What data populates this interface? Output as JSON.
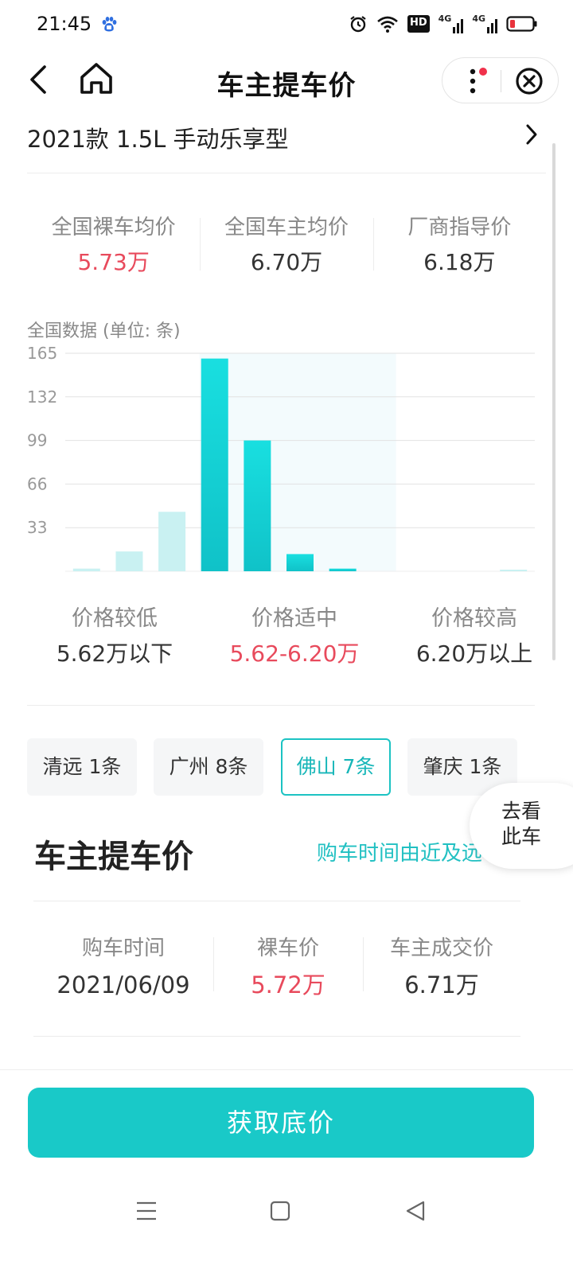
{
  "status_bar": {
    "time": "21:45",
    "icons": [
      "baidu-paw-icon",
      "alarm-icon",
      "wifi-icon",
      "hd-icon",
      "signal-4g-icon",
      "signal-4g-icon",
      "battery-low-icon"
    ],
    "hd_label": "HD",
    "net_label_1": "4G",
    "net_label_2": "4G"
  },
  "header": {
    "title": "车主提车价"
  },
  "model": {
    "name": "2021款 1.5L 手动乐享型"
  },
  "price_summary": [
    {
      "label": "全国裸车均价",
      "value": "5.73万",
      "highlight": true
    },
    {
      "label": "全国车主均价",
      "value": "6.70万",
      "highlight": false
    },
    {
      "label": "厂商指导价",
      "value": "6.18万",
      "highlight": false
    }
  ],
  "chart_data": {
    "type": "bar",
    "title": "全国数据 (单位: 条)",
    "yticks": [
      165,
      132,
      99,
      66,
      33
    ],
    "ylim": [
      0,
      165
    ],
    "values": [
      2,
      15,
      45,
      161,
      99,
      13,
      2,
      0,
      0,
      0,
      1
    ],
    "emphasis": [
      false,
      false,
      false,
      true,
      true,
      true,
      true,
      false,
      false,
      false,
      false
    ],
    "bar_color": "#19dfe0",
    "light_bar_color": "#c9f1f2",
    "band_color": "#f3fbfd"
  },
  "ranges": [
    {
      "label": "价格较低",
      "value": "5.62万以下",
      "highlight": false
    },
    {
      "label": "价格适中",
      "value": "5.62-6.20万",
      "highlight": true
    },
    {
      "label": "价格较高",
      "value": "6.20万以上",
      "highlight": false
    }
  ],
  "cities": [
    {
      "label": "清远 1条",
      "active": false
    },
    {
      "label": "广州 8条",
      "active": false
    },
    {
      "label": "佛山 7条",
      "active": true
    },
    {
      "label": "肇庆 1条",
      "active": false
    }
  ],
  "float_button": {
    "line1": "去看",
    "line2": "此车"
  },
  "section": {
    "title": "车主提车价",
    "sort_label": "购车时间由近及远"
  },
  "record": {
    "date_label": "购车时间",
    "date": "2021/06/09",
    "bare_label": "裸车价",
    "bare_price": "5.72万",
    "deal_label": "车主成交价",
    "deal_price": "6.71万"
  },
  "cta": {
    "label": "获取底价"
  },
  "colors": {
    "accent": "#19c9c8",
    "price_red": "#e84a5c",
    "notice_dot": "#f0314b"
  }
}
